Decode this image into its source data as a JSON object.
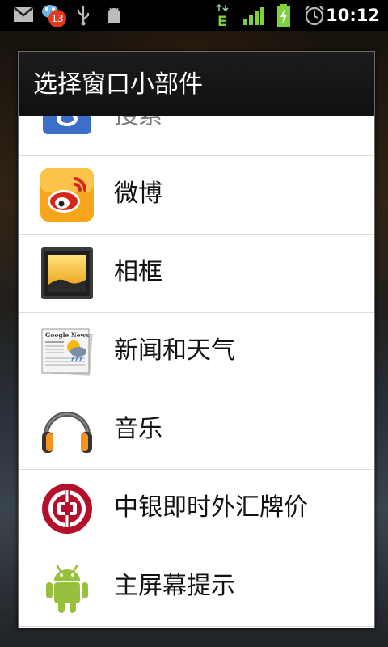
{
  "status_bar": {
    "time": "10:12",
    "notification_count": "13",
    "network_type": "E",
    "icons": [
      "gmail-icon",
      "notification-badge-icon",
      "usb-icon",
      "android-debug-icon",
      "network-type-icon",
      "signal-icon",
      "battery-charging-icon",
      "alarm-icon"
    ]
  },
  "dialog": {
    "title": "选择窗口小部件",
    "items": [
      {
        "label": "搜索",
        "icon": "search-widget-icon"
      },
      {
        "label": "微博",
        "icon": "weibo-icon"
      },
      {
        "label": "相框",
        "icon": "picture-frame-icon"
      },
      {
        "label": "新闻和天气",
        "icon": "news-weather-icon"
      },
      {
        "label": "音乐",
        "icon": "headphones-icon"
      },
      {
        "label": "中银即时外汇牌价",
        "icon": "bank-of-china-icon"
      },
      {
        "label": "主屏幕提示",
        "icon": "android-robot-icon"
      }
    ]
  },
  "colors": {
    "dialog_header": "#101010",
    "weibo_orange": "#f7a51a",
    "boc_red": "#b5102b",
    "android_green": "#97c03d"
  }
}
